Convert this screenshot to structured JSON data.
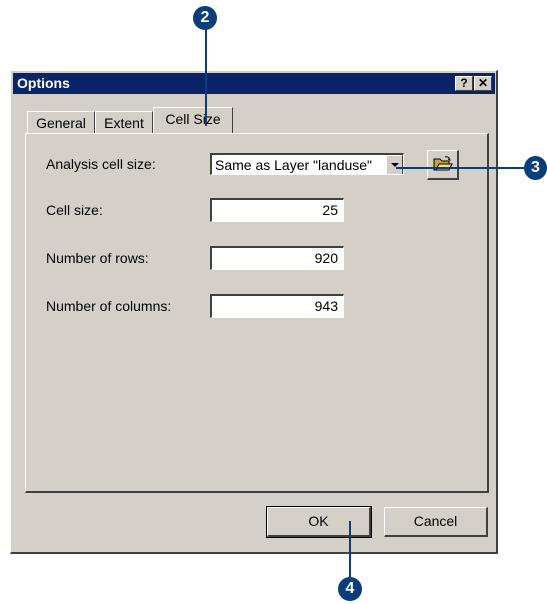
{
  "window": {
    "title": "Options",
    "help_label": "?",
    "close_label": "✕"
  },
  "tabs": [
    "General",
    "Extent",
    "Cell Size"
  ],
  "cell_size_tab": {
    "analysis_label": "Analysis cell size:",
    "analysis_value": "Same as Layer \"landuse\"",
    "cell_size_label": "Cell size:",
    "cell_size_value": "25",
    "rows_label": "Number of rows:",
    "rows_value": "920",
    "cols_label": "Number of columns:",
    "cols_value": "943"
  },
  "buttons": {
    "ok": "OK",
    "cancel": "Cancel"
  },
  "callouts": {
    "tab": "2",
    "browse": "3",
    "ok": "4"
  },
  "colors": {
    "titlebar": "#0a246a",
    "face": "#d4d0c8",
    "callout": "#0a3d7a"
  },
  "icons": {
    "browse": "open-folder-icon",
    "dropdown": "chevron-down-icon"
  }
}
